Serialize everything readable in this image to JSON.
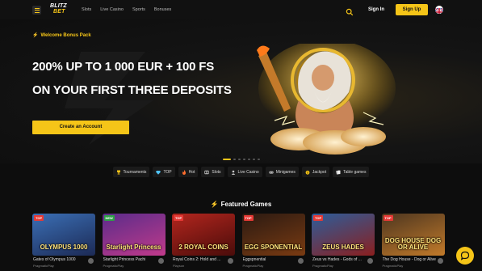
{
  "header": {
    "logo_top": "BLITZ",
    "logo_bottom": "BET",
    "nav": [
      "Slots",
      "Live Casino",
      "Sports",
      "Bonuses"
    ],
    "signin_label": "Sign In",
    "signup_label": "Sign Up"
  },
  "hero": {
    "tag": "Welcome Bonus Pack",
    "headline_line1": "200% UP TO 1 000 EUR + 100 FS",
    "headline_line2": "ON YOUR FIRST THREE DEPOSITS",
    "cta_label": "Create an Account",
    "slides_total": 7,
    "slide_active": 1
  },
  "categories": [
    {
      "label": "Tournaments",
      "icon": "trophy-icon"
    },
    {
      "label": "TOP",
      "icon": "diamond-icon"
    },
    {
      "label": "Hot",
      "icon": "fire-icon"
    },
    {
      "label": "Slots",
      "icon": "slot-icon"
    },
    {
      "label": "Live Casino",
      "icon": "dealer-icon"
    },
    {
      "label": "Minigames",
      "icon": "gamepad-icon"
    },
    {
      "label": "Jackpot",
      "icon": "jackpot-icon"
    },
    {
      "label": "Table games",
      "icon": "cards-icon"
    }
  ],
  "featured": {
    "title": "Featured Games",
    "games": [
      {
        "name": "Gates of Olympus 1000",
        "provider": "PragmaticPlay",
        "badge": "TOP",
        "thumb_text": "OLYMPUS 1000",
        "badge_color": "#e53935",
        "bg1": "#3b6fb5",
        "bg2": "#1c2a55"
      },
      {
        "name": "Starlight Princess Pachi",
        "provider": "PragmaticPlay",
        "badge": "NEW",
        "thumb_text": "Starlight Princess",
        "badge_color": "#2e9e47",
        "bg1": "#5b2c8a",
        "bg2": "#c03a8a"
      },
      {
        "name": "Royal Coins 2: Hold and ...",
        "provider": "Playson",
        "badge": "TOP",
        "thumb_text": "2 ROYAL COINS",
        "badge_color": "#e53935",
        "bg1": "#b3261e",
        "bg2": "#4a0c0a"
      },
      {
        "name": "Eggspnential",
        "provider": "PragmaticPlay",
        "badge": "TOP",
        "thumb_text": "EGG SPONENTIAL",
        "badge_color": "#e53935",
        "bg1": "#2b1a12",
        "bg2": "#7a3b12"
      },
      {
        "name": "Zeus vs Hades - Gods of ...",
        "provider": "PragmaticPlay",
        "badge": "TOP",
        "thumb_text": "ZEUS HADES",
        "badge_color": "#e53935",
        "bg1": "#2d5d9a",
        "bg2": "#8a1f1f"
      },
      {
        "name": "The Dog House - Dog or Alive",
        "provider": "PragmaticPlay",
        "badge": "TOP",
        "thumb_text": "DOG HOUSE DOG OR ALIVE",
        "badge_color": "#e53935",
        "bg1": "#4d3620",
        "bg2": "#c27a2a"
      }
    ]
  },
  "colors": {
    "accent": "#f5c518",
    "background": "#0d0d0d"
  }
}
